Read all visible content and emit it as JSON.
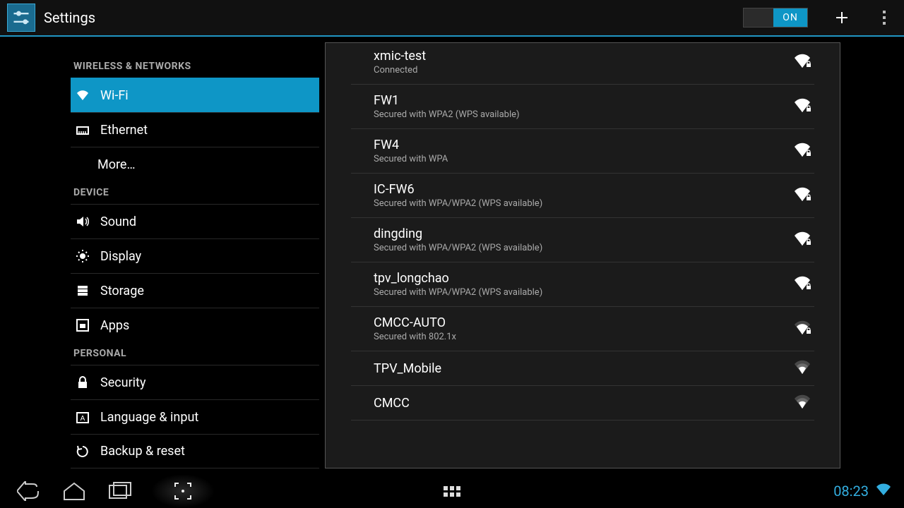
{
  "header": {
    "title": "Settings",
    "switch_label": "ON"
  },
  "sidebar": {
    "categories": [
      {
        "title": "WIRELESS & NETWORKS",
        "items": [
          {
            "id": "wifi",
            "label": "Wi-Fi",
            "selected": true,
            "icon": "wifi"
          },
          {
            "id": "ethernet",
            "label": "Ethernet",
            "icon": "ethernet"
          },
          {
            "id": "more",
            "label": "More…",
            "indent": true
          }
        ]
      },
      {
        "title": "DEVICE",
        "items": [
          {
            "id": "sound",
            "label": "Sound",
            "icon": "sound"
          },
          {
            "id": "display",
            "label": "Display",
            "icon": "display"
          },
          {
            "id": "storage",
            "label": "Storage",
            "icon": "storage"
          },
          {
            "id": "apps",
            "label": "Apps",
            "icon": "apps"
          }
        ]
      },
      {
        "title": "PERSONAL",
        "items": [
          {
            "id": "security",
            "label": "Security",
            "icon": "security"
          },
          {
            "id": "language",
            "label": "Language & input",
            "icon": "language"
          },
          {
            "id": "backup",
            "label": "Backup & reset",
            "icon": "backup"
          }
        ]
      }
    ]
  },
  "networks": [
    {
      "ssid": "xmic-test",
      "status": "Connected",
      "secured": true,
      "strength": 4
    },
    {
      "ssid": "FW1",
      "status": "Secured with WPA2 (WPS available)",
      "secured": true,
      "strength": 4
    },
    {
      "ssid": "FW4",
      "status": "Secured with WPA",
      "secured": true,
      "strength": 4
    },
    {
      "ssid": "IC-FW6",
      "status": "Secured with WPA/WPA2 (WPS available)",
      "secured": true,
      "strength": 4
    },
    {
      "ssid": "dingding",
      "status": "Secured with WPA/WPA2 (WPS available)",
      "secured": true,
      "strength": 4
    },
    {
      "ssid": "tpv_longchao",
      "status": "Secured with WPA/WPA2 (WPS available)",
      "secured": true,
      "strength": 4
    },
    {
      "ssid": "CMCC-AUTO",
      "status": "Secured with 802.1x",
      "secured": true,
      "strength": 3
    },
    {
      "ssid": "TPV_Mobile",
      "status": "",
      "secured": false,
      "strength": 2
    },
    {
      "ssid": "CMCC",
      "status": "",
      "secured": false,
      "strength": 2
    }
  ],
  "statusbar": {
    "time": "08:23"
  }
}
